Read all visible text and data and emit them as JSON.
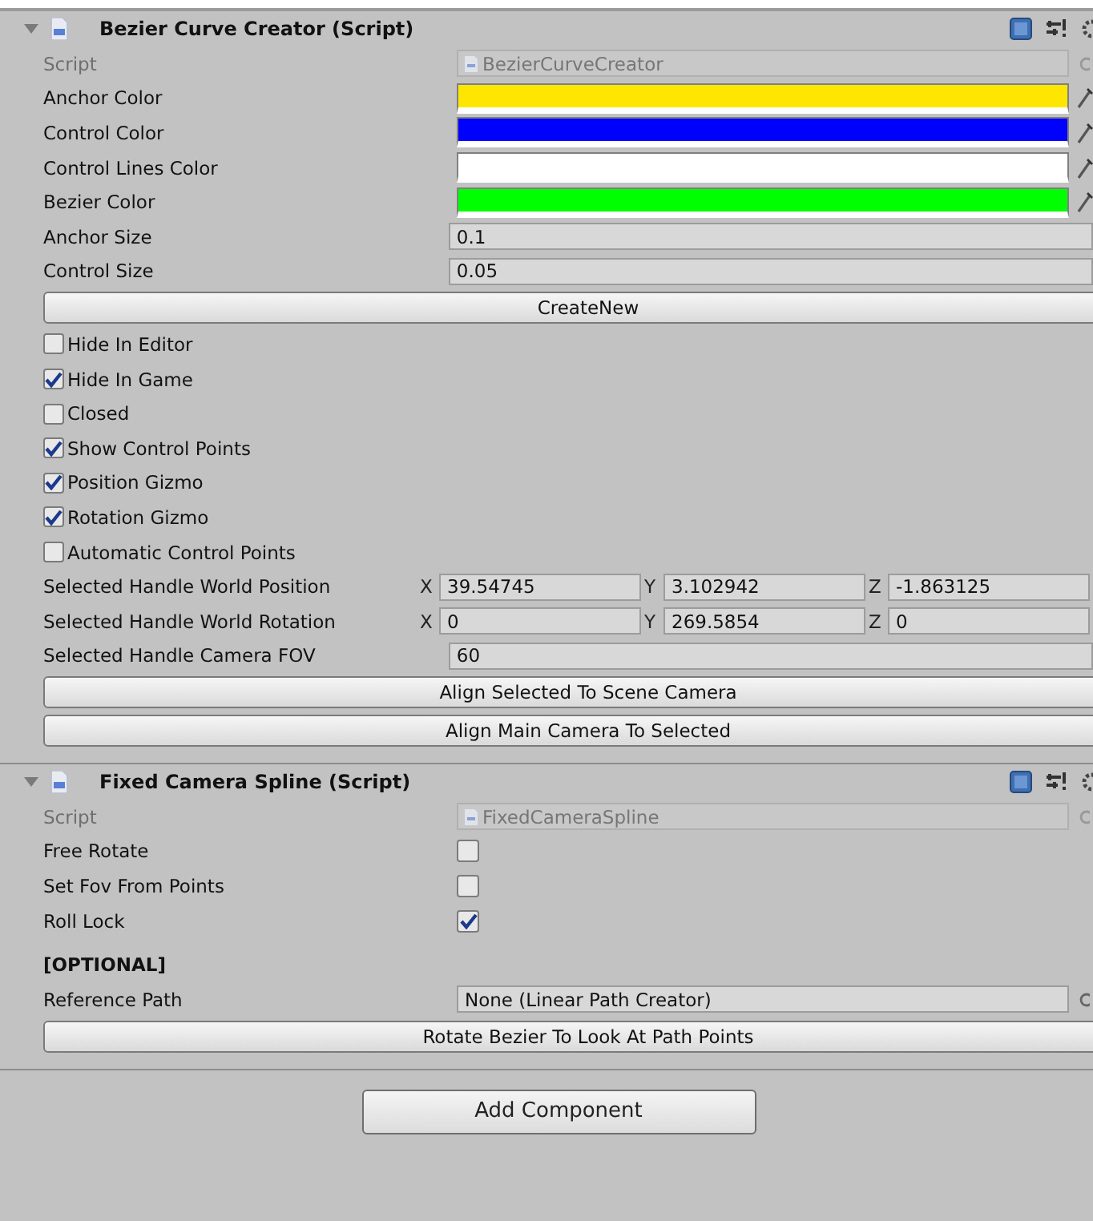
{
  "components": [
    {
      "title": "Bezier Curve Creator (Script)",
      "expanded": true,
      "rows": [
        {
          "kind": "script",
          "label": "Script",
          "value": "BezierCurveCreator"
        },
        {
          "kind": "color",
          "label": "Anchor Color",
          "color": "#ffe600"
        },
        {
          "kind": "color",
          "label": "Control Color",
          "color": "#0000ff"
        },
        {
          "kind": "color",
          "label": "Control Lines Color",
          "color": "#ffffff"
        },
        {
          "kind": "color",
          "label": "Bezier Color",
          "color": "#00ff00"
        },
        {
          "kind": "number",
          "label": "Anchor Size",
          "value": "0.1"
        },
        {
          "kind": "number",
          "label": "Control Size",
          "value": "0.05"
        },
        {
          "kind": "button",
          "label": "CreateNew"
        },
        {
          "kind": "toggle",
          "label": "Hide In Editor",
          "checked": false
        },
        {
          "kind": "toggle",
          "label": "Hide In Game",
          "checked": true
        },
        {
          "kind": "toggle",
          "label": "Closed",
          "checked": false
        },
        {
          "kind": "toggle",
          "label": "Show Control Points",
          "checked": true
        },
        {
          "kind": "toggle",
          "label": "Position Gizmo",
          "checked": true
        },
        {
          "kind": "toggle",
          "label": "Rotation Gizmo",
          "checked": true
        },
        {
          "kind": "toggle",
          "label": "Automatic Control Points",
          "checked": false
        },
        {
          "kind": "vector3",
          "label": "Selected Handle World Position",
          "values": [
            {
              "axis": "X",
              "value": "39.54745"
            },
            {
              "axis": "Y",
              "value": "3.102942"
            },
            {
              "axis": "Z",
              "value": "-1.863125"
            }
          ]
        },
        {
          "kind": "vector3",
          "label": "Selected Handle World Rotation",
          "values": [
            {
              "axis": "X",
              "value": "0"
            },
            {
              "axis": "Y",
              "value": "269.5854"
            },
            {
              "axis": "Z",
              "value": "0"
            }
          ]
        },
        {
          "kind": "number",
          "label": "Selected Handle Camera FOV",
          "value": "60"
        },
        {
          "kind": "button",
          "label": "Align Selected To Scene Camera"
        },
        {
          "kind": "button",
          "label": "Align Main Camera To Selected"
        }
      ]
    },
    {
      "title": "Fixed Camera Spline (Script)",
      "expanded": true,
      "rows": [
        {
          "kind": "script",
          "label": "Script",
          "value": "FixedCameraSpline"
        },
        {
          "kind": "checkfield",
          "label": "Free Rotate",
          "checked": false
        },
        {
          "kind": "checkfield",
          "label": "Set Fov From Points",
          "checked": false
        },
        {
          "kind": "checkfield",
          "label": "Roll Lock",
          "checked": true
        },
        {
          "kind": "heading",
          "label": "[OPTIONAL]"
        },
        {
          "kind": "object",
          "label": "Reference Path",
          "value": "None (Linear Path Creator)"
        },
        {
          "kind": "button",
          "label": "Rotate Bezier To Look At Path Points"
        }
      ]
    }
  ],
  "add_component": "Add Component"
}
